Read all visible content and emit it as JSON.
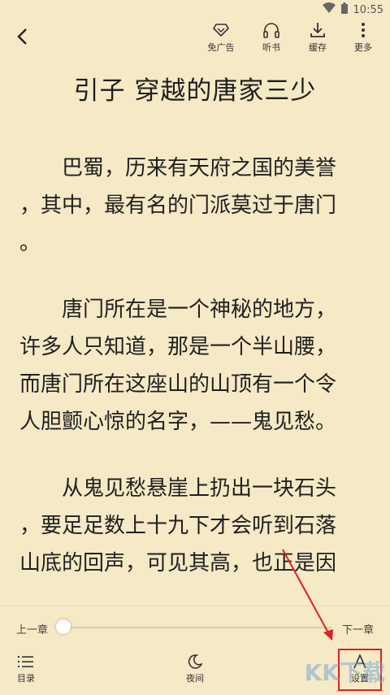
{
  "status_bar": {
    "time": "10:55",
    "wifi_icon": "wifi-icon",
    "battery_icon": "battery-icon"
  },
  "toolbar": {
    "back_icon": "back-arrow-icon",
    "items": [
      {
        "label": "免广告",
        "icon": "diamond-icon"
      },
      {
        "label": "听书",
        "icon": "headphones-icon"
      },
      {
        "label": "缓存",
        "icon": "download-icon"
      },
      {
        "label": "更多",
        "icon": "more-vertical-icon"
      }
    ]
  },
  "chapter": {
    "title": "引子 穿越的唐家三少",
    "lines_p1": [
      "　　巴蜀，历来有天府之国的美誉",
      "，其中，最有名的门派莫过于唐门",
      "。"
    ],
    "lines_p2": [
      "　　唐门所在是一个神秘的地方，",
      "许多人只知道，那是一个半山腰，",
      "而唐门所在这座山的山顶有一个令",
      "人胆颤心惊的名字，——鬼见愁。"
    ],
    "lines_p3": [
      "　　从鬼见愁悬崖上扔出一块石头",
      "，要足足数上十九下才会听到石落",
      "山底的回声，可见其高，也正是因"
    ]
  },
  "progress": {
    "prev_label": "上一章",
    "next_label": "下一章",
    "value": 0
  },
  "bottom_bar": {
    "items": [
      {
        "label": "目录",
        "icon": "list-icon"
      },
      {
        "label": "夜间",
        "icon": "moon-icon"
      },
      {
        "label": "设置",
        "icon": "font-icon"
      }
    ]
  },
  "colors": {
    "background": "#f5e9c6",
    "highlight": "#e02020"
  },
  "watermark": "KK下载"
}
